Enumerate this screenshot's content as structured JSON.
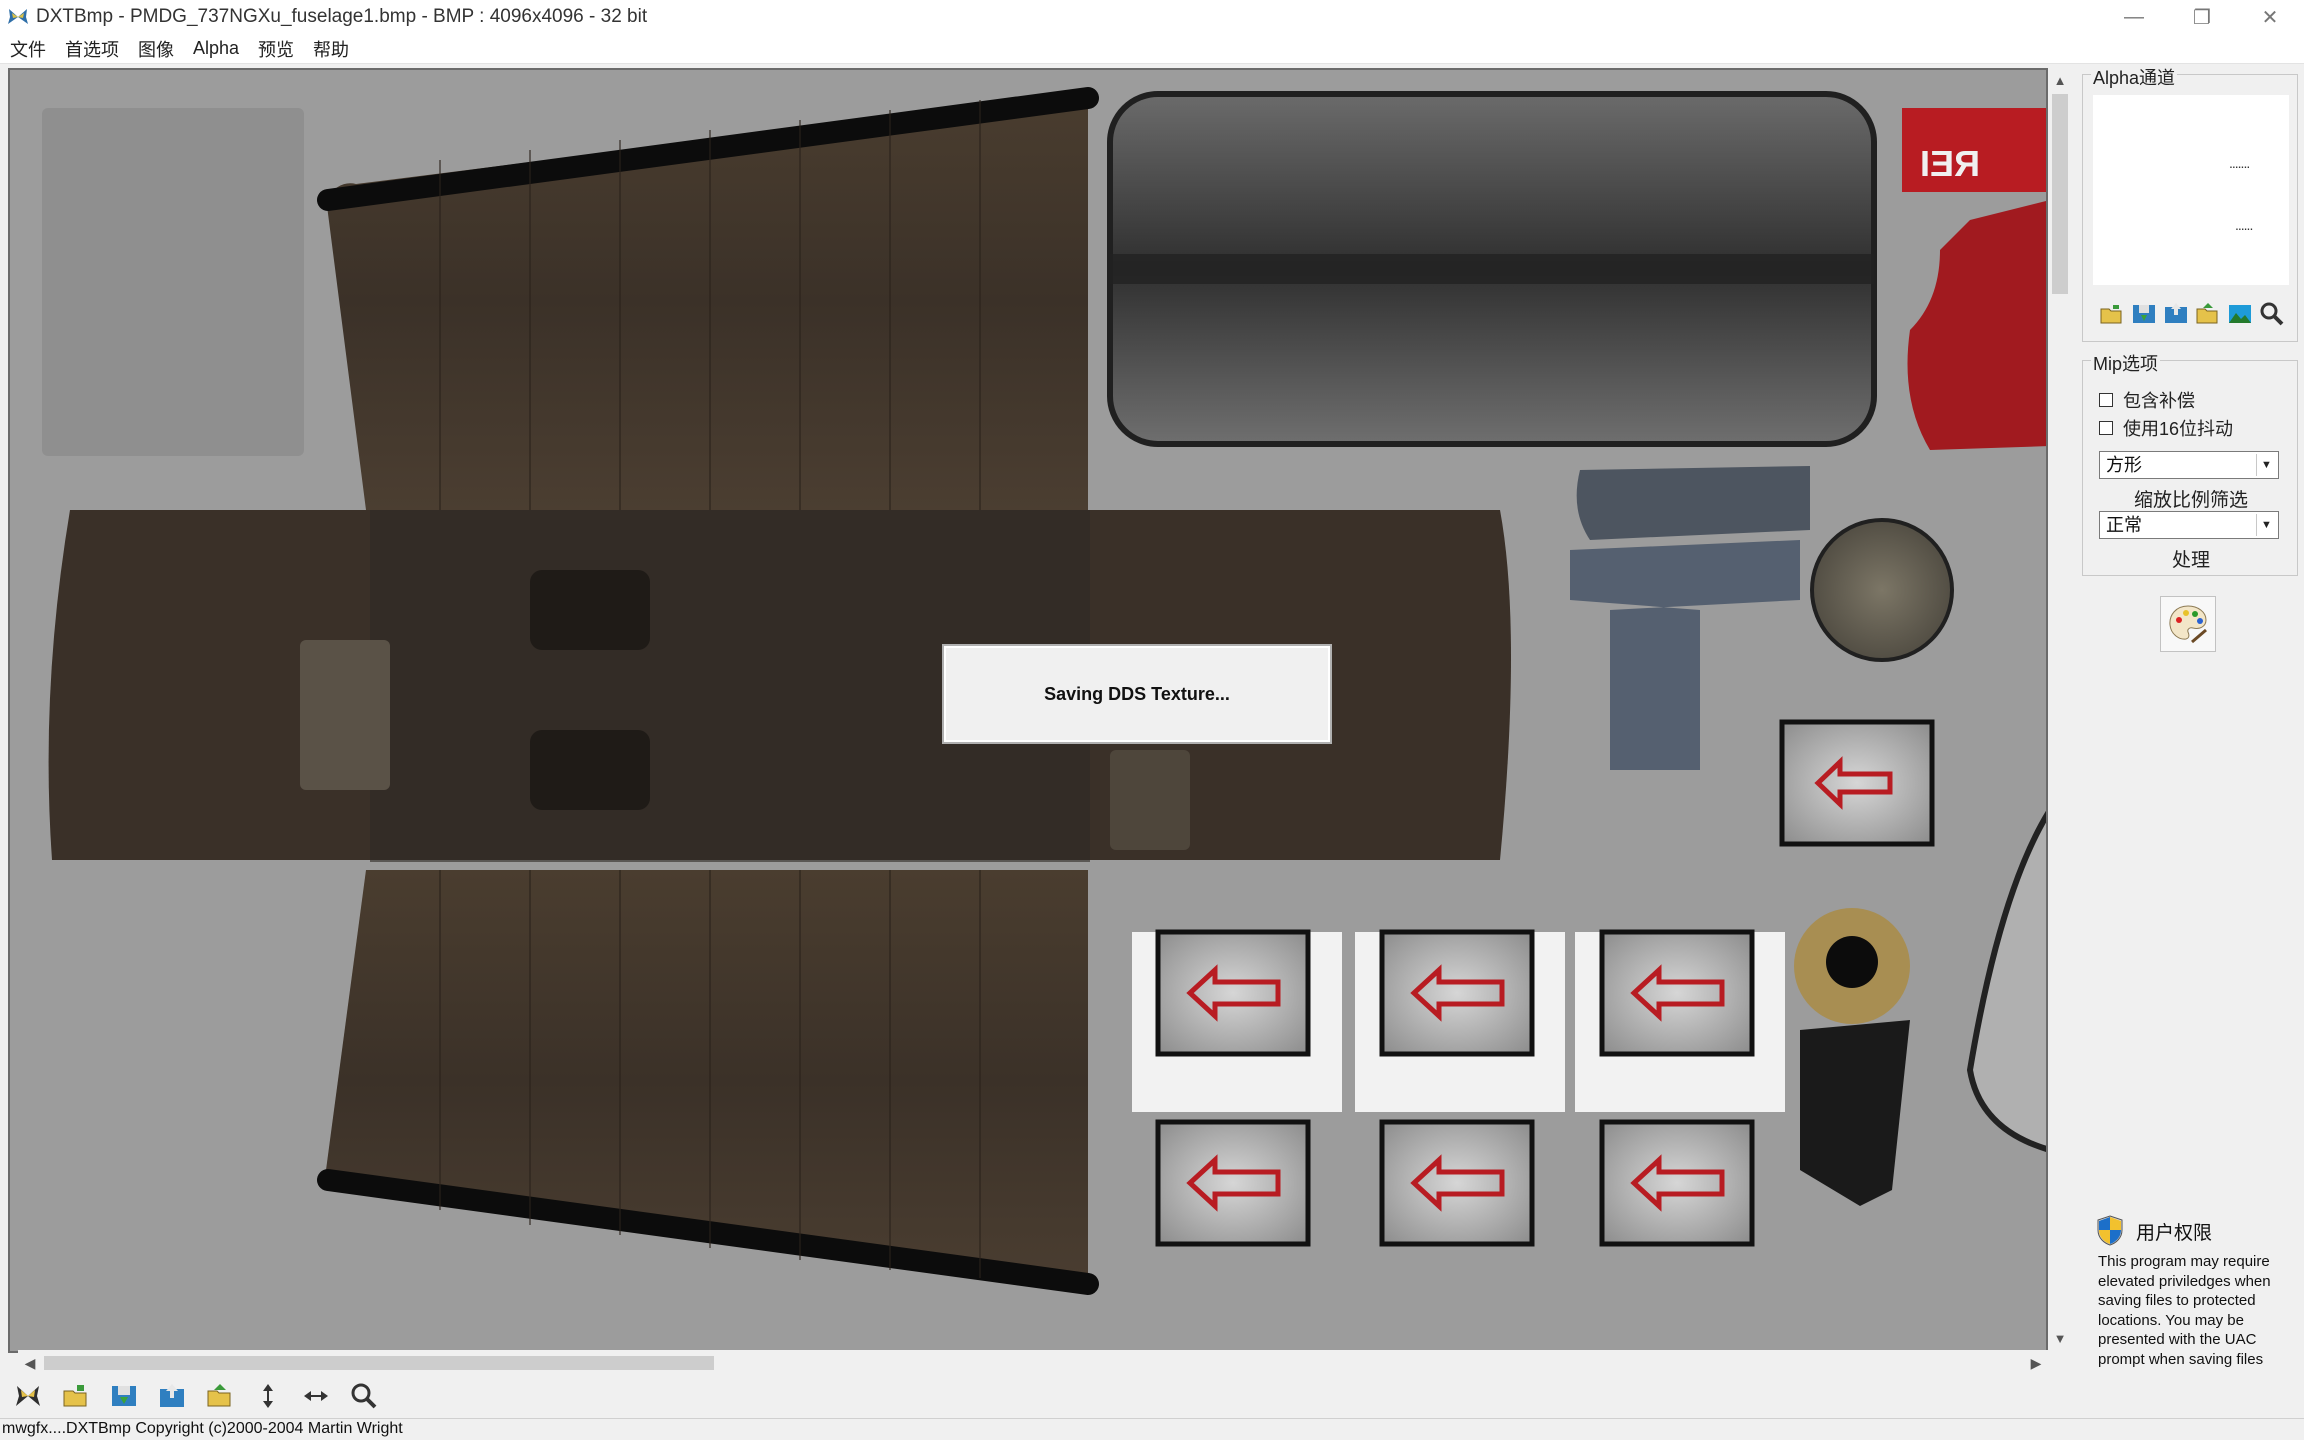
{
  "window": {
    "title": "DXTBmp - PMDG_737NGXu_fuselage1.bmp - BMP : 4096x4096 - 32 bit",
    "controls": {
      "minimize": "—",
      "restore": "❐",
      "close": "✕"
    }
  },
  "menu": [
    "文件",
    "首选项",
    "图像",
    "Alpha",
    "预览",
    "帮助"
  ],
  "dialog": {
    "text": "Saving DDS Texture..."
  },
  "panel": {
    "alpha_group_label": "Alpha通道",
    "mip_group_label": "Mip选项",
    "mip_checkbox_1": "包含补偿",
    "mip_checkbox_2": "使用16位抖动",
    "shape_select": "方形",
    "scale_filter_label": "缩放比例筛选",
    "filter_select": "正常",
    "process_label": "处理",
    "uac_title": "用户权限",
    "uac_text": "This program may require elevated priviledges when saving files to protected locations. You may be presented with the UAC prompt when saving files"
  },
  "scroll": {
    "up": "▲",
    "down": "▼",
    "left": "◀",
    "right": "▶"
  },
  "status": {
    "text": "mwgfx....DXTBmp Copyright (c)2000-2004 Martin Wright"
  },
  "icons": {
    "alpha_tools": [
      "open-folder-icon",
      "save-icon",
      "import-icon",
      "export-folder-icon",
      "landscape-icon",
      "zoom-icon"
    ],
    "bottom_tools": [
      "butterfly-icon",
      "open-folder-icon",
      "save-icon",
      "import-icon",
      "export-folder-icon",
      "flip-vertical-icon",
      "flip-horizontal-icon",
      "zoom-icon"
    ],
    "process": "palette-icon",
    "uac": "shield-icon"
  },
  "colors": {
    "canvas_bg": "#9a9a9a",
    "metal_brown": "#4a3d30",
    "seal_red": "#b81c22",
    "accent_blue": "#1c6fc9"
  }
}
